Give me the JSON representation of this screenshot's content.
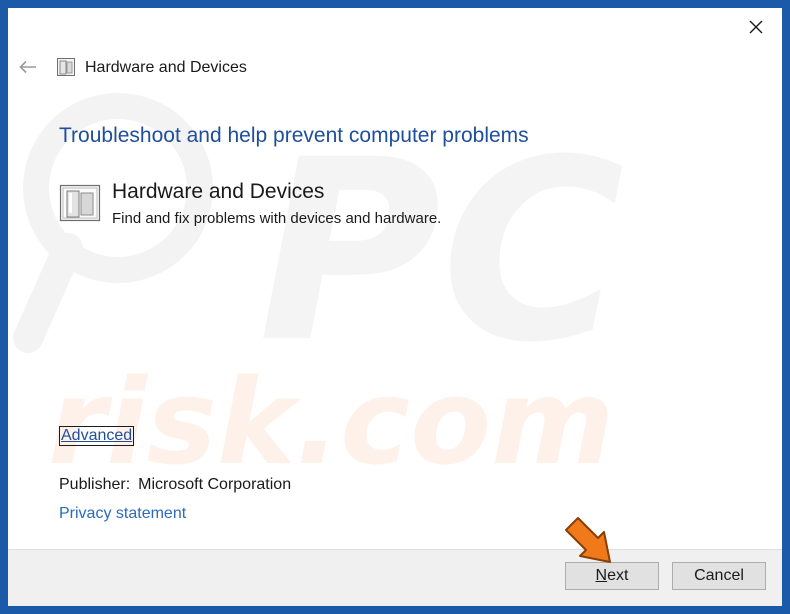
{
  "window": {
    "title": "Hardware and Devices",
    "close_icon": "close-icon",
    "back_icon": "back-arrow-icon"
  },
  "main": {
    "heading": "Troubleshoot and help prevent computer problems",
    "tool": {
      "icon": "hardware-devices-icon",
      "title": "Hardware and Devices",
      "description": "Find and fix problems with devices and hardware."
    },
    "advanced_label": "Advanced",
    "publisher_label": "Publisher:",
    "publisher_value": "Microsoft Corporation",
    "privacy_label": "Privacy statement"
  },
  "footer": {
    "next_first": "N",
    "next_rest": "ext",
    "cancel_label": "Cancel"
  },
  "watermark": {
    "text_top": "PC",
    "text_bottom": "risk.com"
  },
  "colors": {
    "accent": "#1f4e9c",
    "link": "#2a6ac0",
    "border": "#1b5aa8",
    "annotation_arrow": "#f07a1a"
  }
}
